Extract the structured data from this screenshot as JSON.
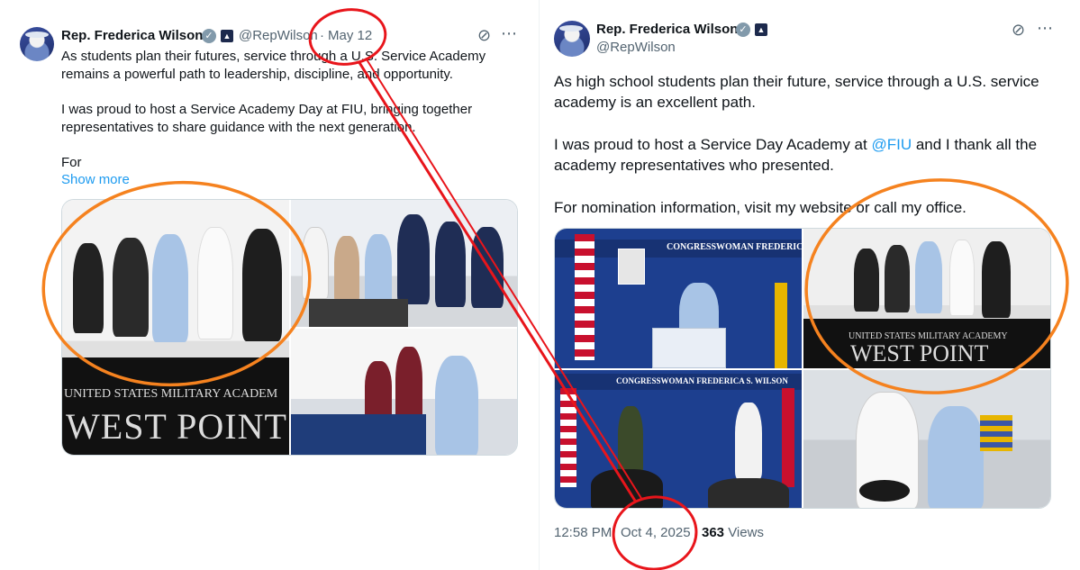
{
  "left_tweet": {
    "author_name": "Rep. Frederica Wilson",
    "handle": "@RepWilson",
    "separator": "·",
    "date": "May 12",
    "lines": [
      "As students plan their futures, service through a U.S. Service Academy",
      "remains a powerful path to leadership, discipline, and opportunity.",
      "I was proud to host a Service Academy Day at FIU, bringing together",
      "representatives to share guidance with the next generation.",
      "For"
    ],
    "show_more": "Show more",
    "photo_text": {
      "table_line1": "UNITED STATES MILITARY ACADEM",
      "table_line2": "WEST POINT"
    }
  },
  "right_tweet": {
    "author_name": "Rep. Frederica Wilson",
    "handle": "@RepWilson",
    "para1_line1": "As high school students plan their future, service through a U.S. service",
    "para1_line2": "academy is an excellent path.",
    "para2_line1_before": "I was proud to host a Service Day Academy at ",
    "para2_mention": "@FIU",
    "para2_line1_after": " and I thank all the",
    "para2_line2": "academy representatives who presented.",
    "para3": "For nomination information, visit my website or call my office.",
    "photo_text": {
      "banner": "CONGRESSWOMAN FREDERICA S",
      "banner2": "CONGRESSWOMAN FREDERICA S. WILSON",
      "table_line1": "UNITED STATES MILITARY ACADEMY",
      "table_line2": "WEST POINT"
    },
    "time": "12:58 PM",
    "separator": "·",
    "date": "Oct 4, 2025",
    "views_count": "363",
    "views_label": "Views"
  },
  "icons": {
    "verified": "verified-badge-icon",
    "affiliate": "house-seal-icon",
    "grok": "grok-icon",
    "more": "more-icon"
  },
  "annotation_colors": {
    "red": "#e8151b",
    "orange": "#f5821f"
  }
}
